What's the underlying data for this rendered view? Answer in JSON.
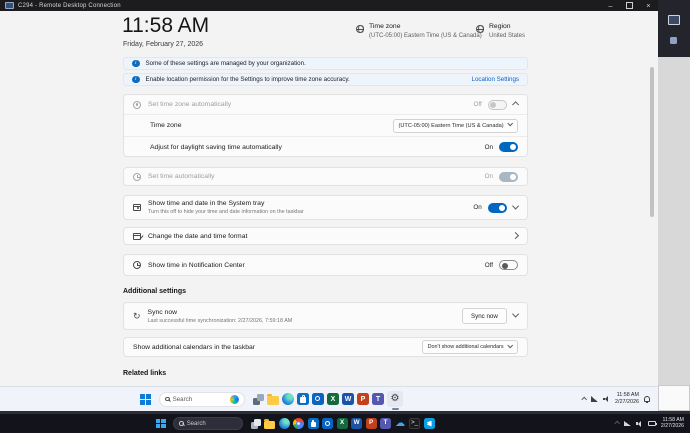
{
  "window": {
    "title": "C294 - Remote Desktop Connection"
  },
  "glyphs": {
    "minimize": "–",
    "close": "×",
    "info": "i",
    "gear": "⚙",
    "sync": "↻",
    "cloud": "☁",
    "terminal": ">_",
    "excel": "X",
    "word": "W",
    "powerpoint": "P",
    "teams": "T"
  },
  "page": {
    "time": "11:58 AM",
    "date": "Friday, February 27, 2026",
    "timezone": {
      "label": "Time zone",
      "value": "(UTC-05:00) Eastern Time (US & Canada)"
    },
    "region": {
      "label": "Region",
      "value": "United States"
    },
    "banners": {
      "managed": "Some of these settings are managed by your organization.",
      "location": "Enable location permission for the Settings to improve time zone accuracy.",
      "location_link": "Location Settings"
    },
    "rows": {
      "tz_auto": {
        "title": "Set time zone automatically",
        "state": "Off"
      },
      "tz_select": {
        "label": "Time zone",
        "value": "(UTC-05:00) Eastern Time (US & Canada)"
      },
      "dst": {
        "title": "Adjust for daylight saving time automatically",
        "state": "On"
      },
      "time_auto": {
        "title": "Set time automatically",
        "state": "On"
      },
      "systray": {
        "title": "Show time and date in the System tray",
        "subtitle": "Turn this off to hide your time and date information on the taskbar",
        "state": "On"
      },
      "format": {
        "title": "Change the date and time format"
      },
      "notify": {
        "title": "Show time in Notification Center",
        "state": "Off"
      },
      "sync": {
        "title": "Sync now",
        "subtitle": "Last successful time synchronization: 2/27/2026, 7:59:18 AM",
        "button": "Sync now"
      },
      "calendars": {
        "title": "Show additional calendars in the taskbar",
        "value": "Don't show additional calendars"
      }
    },
    "sections": {
      "additional": "Additional settings",
      "related": "Related links"
    },
    "accent_color": "#0067c0"
  },
  "remote_taskbar": {
    "search": "Search",
    "time": "11:58 AM",
    "date": "2/27/2026"
  },
  "local_taskbar": {
    "search": "Search",
    "time": "11:58 AM",
    "date": "2/27/2026"
  }
}
